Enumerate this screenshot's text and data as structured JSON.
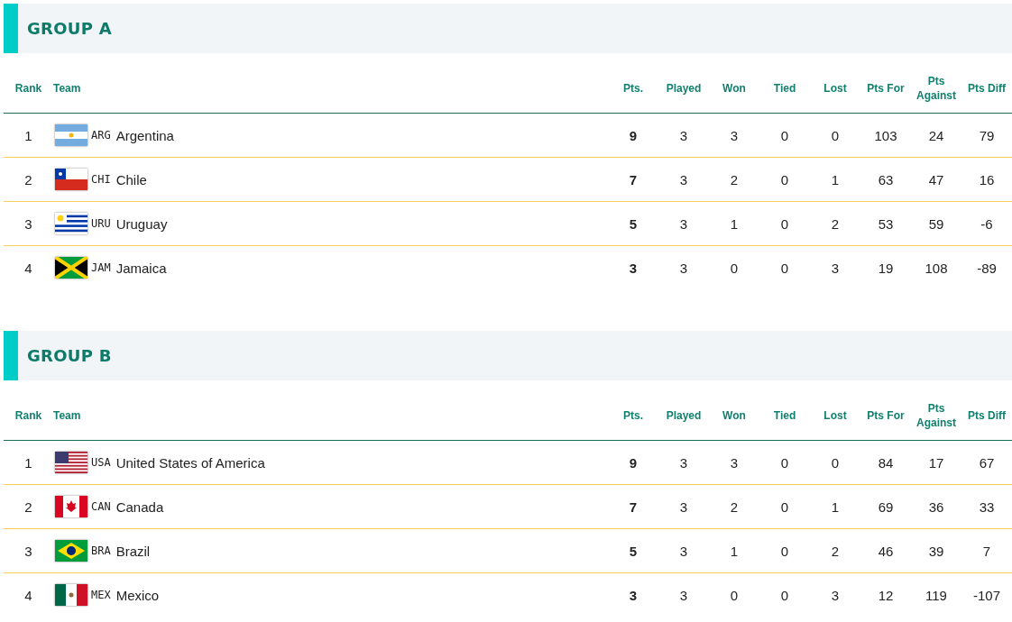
{
  "groups": [
    {
      "title": "GROUP A",
      "columns": [
        "Rank",
        "Team",
        "Pts.",
        "Played",
        "Won",
        "Tied",
        "Lost",
        "Pts For",
        "Pts Against",
        "Pts Diff"
      ],
      "rows": [
        {
          "rank": "1",
          "kind": "argentina",
          "code": "ARG",
          "team": "Argentina",
          "pts": "9",
          "played": "3",
          "won": "3",
          "tied": "0",
          "lost": "0",
          "pts_for": "103",
          "pts_against": "24",
          "pts_diff": "79"
        },
        {
          "rank": "2",
          "kind": "chile",
          "code": "CHI",
          "team": "Chile",
          "pts": "7",
          "played": "3",
          "won": "2",
          "tied": "0",
          "lost": "1",
          "pts_for": "63",
          "pts_against": "47",
          "pts_diff": "16"
        },
        {
          "rank": "3",
          "kind": "uruguay",
          "code": "URU",
          "team": "Uruguay",
          "pts": "5",
          "played": "3",
          "won": "1",
          "tied": "0",
          "lost": "2",
          "pts_for": "53",
          "pts_against": "59",
          "pts_diff": "-6"
        },
        {
          "rank": "4",
          "kind": "jamaica",
          "code": "JAM",
          "team": "Jamaica",
          "pts": "3",
          "played": "3",
          "won": "0",
          "tied": "0",
          "lost": "3",
          "pts_for": "19",
          "pts_against": "108",
          "pts_diff": "-89"
        }
      ]
    },
    {
      "title": "GROUP B",
      "columns": [
        "Rank",
        "Team",
        "Pts.",
        "Played",
        "Won",
        "Tied",
        "Lost",
        "Pts For",
        "Pts Against",
        "Pts Diff"
      ],
      "rows": [
        {
          "rank": "1",
          "kind": "usa",
          "code": "USA",
          "team": "United States of America",
          "pts": "9",
          "played": "3",
          "won": "3",
          "tied": "0",
          "lost": "0",
          "pts_for": "84",
          "pts_against": "17",
          "pts_diff": "67"
        },
        {
          "rank": "2",
          "kind": "canada",
          "code": "CAN",
          "team": "Canada",
          "pts": "7",
          "played": "3",
          "won": "2",
          "tied": "0",
          "lost": "1",
          "pts_for": "69",
          "pts_against": "36",
          "pts_diff": "33"
        },
        {
          "rank": "3",
          "kind": "brazil",
          "code": "BRA",
          "team": "Brazil",
          "pts": "5",
          "played": "3",
          "won": "1",
          "tied": "0",
          "lost": "2",
          "pts_for": "46",
          "pts_against": "39",
          "pts_diff": "7"
        },
        {
          "rank": "4",
          "kind": "mexico",
          "code": "MEX",
          "team": "Mexico",
          "pts": "3",
          "played": "3",
          "won": "0",
          "tied": "0",
          "lost": "3",
          "pts_for": "12",
          "pts_against": "119",
          "pts_diff": "-107"
        }
      ]
    }
  ]
}
